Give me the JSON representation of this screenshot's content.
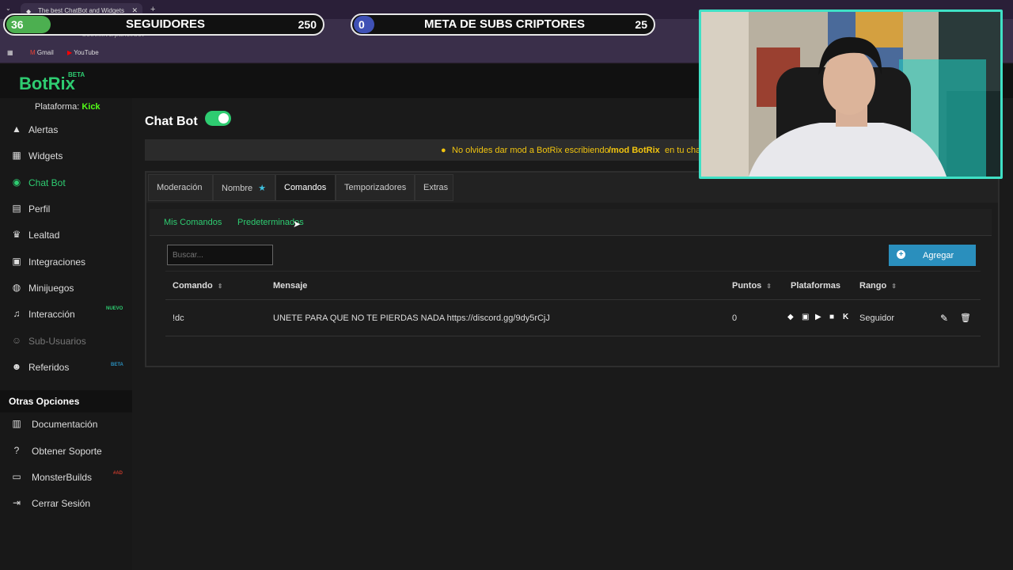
{
  "browser": {
    "tab_title": "The best ChatBot and Widgets",
    "url": "botrix.live/panel/bot",
    "bookmarks": [
      "Gmail",
      "YouTube"
    ]
  },
  "overlay": {
    "followers": {
      "current": "36",
      "label": "SEGUIDORES",
      "goal": "250"
    },
    "subs": {
      "current": "0",
      "label": "META DE SUBS CRIPTORES",
      "goal": "25"
    }
  },
  "brand": {
    "name": "BotRix",
    "badge": "BETA"
  },
  "sidebar": {
    "platform_label": "Plataforma:",
    "platform_value": "Kick",
    "items": [
      {
        "label": "Alertas",
        "icon": "warning-icon"
      },
      {
        "label": "Widgets",
        "icon": "grid-icon"
      },
      {
        "label": "Chat Bot",
        "icon": "robot-icon"
      },
      {
        "label": "Perfil",
        "icon": "id-card-icon"
      },
      {
        "label": "Lealtad",
        "icon": "trophy-icon"
      },
      {
        "label": "Integraciones",
        "icon": "puzzle-icon"
      },
      {
        "label": "Minijuegos",
        "icon": "gamepad-icon"
      },
      {
        "label": "Interacción",
        "icon": "music-icon",
        "tag": "NUEVO"
      },
      {
        "label": "Sub-Usuarios",
        "icon": "users-icon"
      },
      {
        "label": "Referidos",
        "icon": "user-group-icon",
        "tag": "BETA"
      }
    ],
    "other_title": "Otras Opciones",
    "other_items": [
      {
        "label": "Documentación",
        "icon": "book-icon"
      },
      {
        "label": "Obtener Soporte",
        "icon": "help-icon"
      },
      {
        "label": "MonsterBuilds",
        "icon": "laptop-icon",
        "tag": "#AD"
      },
      {
        "label": "Cerrar Sesión",
        "icon": "logout-icon"
      }
    ]
  },
  "main": {
    "title": "Chat Bot",
    "notice": {
      "text": "No olvides dar mod a BotRix escribiendo",
      "command": "/mod BotRix",
      "suffix": "en tu cha"
    },
    "tabs": [
      "Moderación",
      "Nombre",
      "Comandos",
      "Temporizadores",
      "Extras"
    ],
    "subtabs": [
      "Mis Comandos",
      "Predeterminados"
    ],
    "search_placeholder": "Buscar...",
    "add_button": "Agregar",
    "columns": {
      "command": "Comando",
      "message": "Mensaje",
      "points": "Puntos",
      "platforms": "Plataformas",
      "rank": "Rango"
    },
    "rows": [
      {
        "command": "!dc",
        "message": "UNETE PARA QUE NO TE PIERDAS NADA https://discord.gg/9dy5rCjJ",
        "points": "0",
        "rank": "Seguidor"
      }
    ]
  },
  "colors": {
    "accent": "#2ecc71",
    "button": "#2a8fbd",
    "notice": "#f1c40f",
    "webcam_border": "#3fe0c5"
  }
}
